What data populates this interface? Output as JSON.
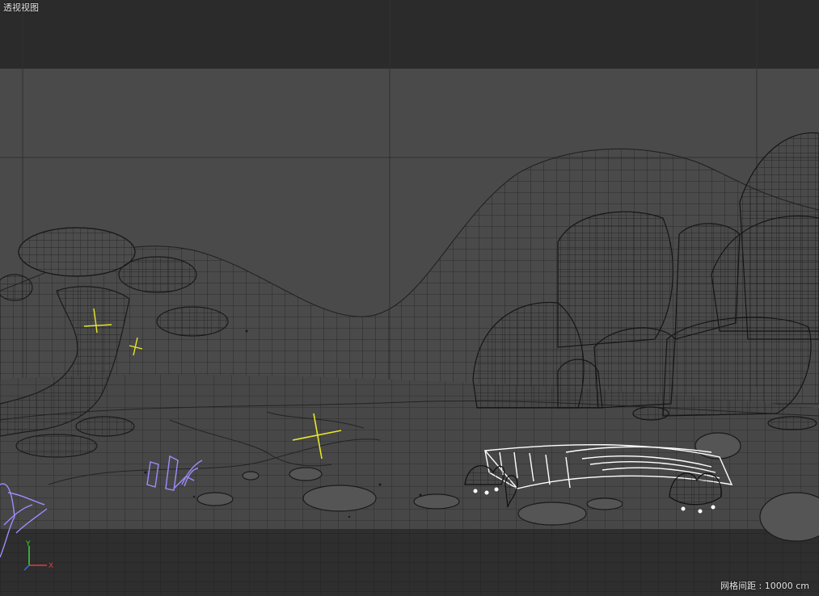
{
  "viewport": {
    "title": "透视视图",
    "grid_spacing_label": "网格间距 : 10000 cm"
  },
  "axes": {
    "x_label": "X",
    "y_label": "Y"
  },
  "colors": {
    "background_top": "#2b2b2b",
    "background_mid": "#4a4a4a",
    "floor_dark": "#2e2e2e",
    "wire": "#1a1a1a",
    "selected_wire": "#ffffff",
    "light_marker": "#e8e82a",
    "plant_wire": "#9f8cff",
    "axis_x": "#e23b3b",
    "axis_y": "#3bd23b"
  },
  "icons": [
    "light-marker-icon",
    "axis-gizmo-icon"
  ]
}
